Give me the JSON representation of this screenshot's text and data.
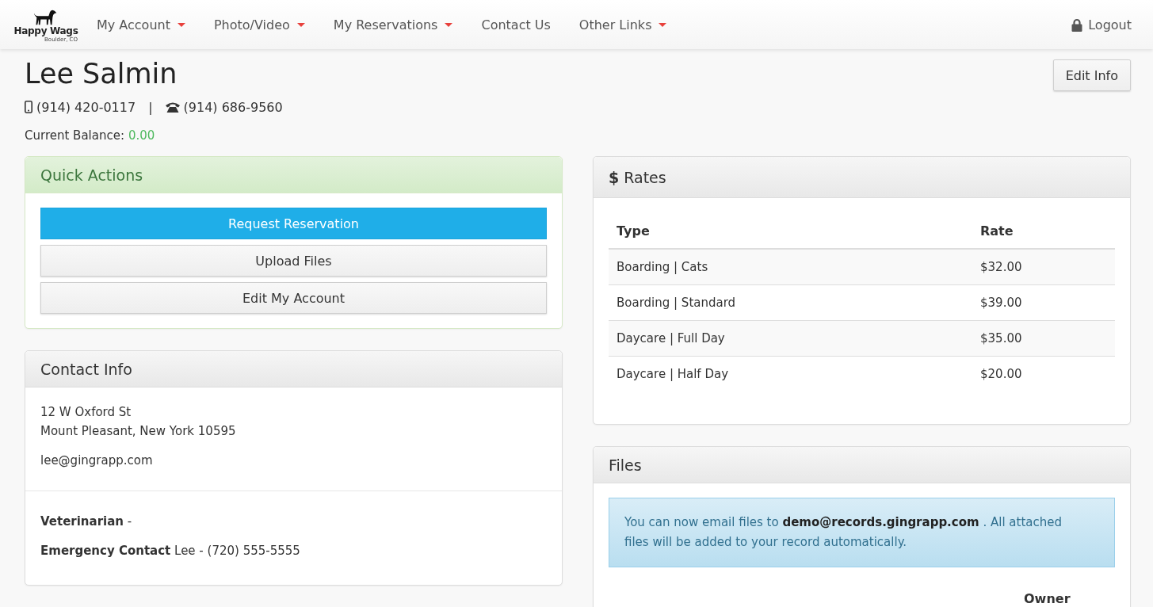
{
  "navbar": {
    "logo": {
      "name": "Happy Wags",
      "location": "Boulder, CO"
    },
    "items": [
      {
        "label": "My Account",
        "dropdown": true
      },
      {
        "label": "Photo/Video",
        "dropdown": true
      },
      {
        "label": "My Reservations",
        "dropdown": true
      },
      {
        "label": "Contact Us",
        "dropdown": false
      },
      {
        "label": "Other Links",
        "dropdown": true
      }
    ],
    "logout": "Logout"
  },
  "profile": {
    "name": "Lee Salmin",
    "phones": [
      {
        "kind": "mobile",
        "number": "(914) 420-0117"
      },
      {
        "kind": "landline",
        "number": "(914) 686-9560"
      }
    ],
    "separator": "|",
    "balance_label": "Current Balance:",
    "balance": "0.00",
    "edit_button": "Edit Info"
  },
  "quick_actions": {
    "title": "Quick Actions",
    "buttons": [
      {
        "label": "Request Reservation",
        "kind": "primary"
      },
      {
        "label": "Upload Files",
        "kind": "default"
      },
      {
        "label": "Edit My Account",
        "kind": "default"
      }
    ]
  },
  "contact_info": {
    "title": "Contact Info",
    "address": [
      "12 W Oxford St",
      "Mount Pleasant, New York 10595"
    ],
    "email": "lee@gingrapp.com",
    "details": [
      "**Veterinarian** -",
      "**Emergency Contact** Lee - (720) 555-5555"
    ]
  },
  "rates": {
    "icon": "$",
    "title": "Rates",
    "columns": [
      "Type",
      "Rate"
    ],
    "rows": [
      [
        "Boarding | Cats",
        "$32.00"
      ],
      [
        "Boarding | Standard",
        "$39.00"
      ],
      [
        "Daycare | Full Day",
        "$35.00"
      ],
      [
        "Daycare | Half Day",
        "$20.00"
      ]
    ]
  },
  "files": {
    "title": "Files",
    "notice": "You can now email files to **demo@records.gingrapp.com** . All attached files will be added to your record automatically.",
    "columns": [
      "Owner"
    ]
  }
}
